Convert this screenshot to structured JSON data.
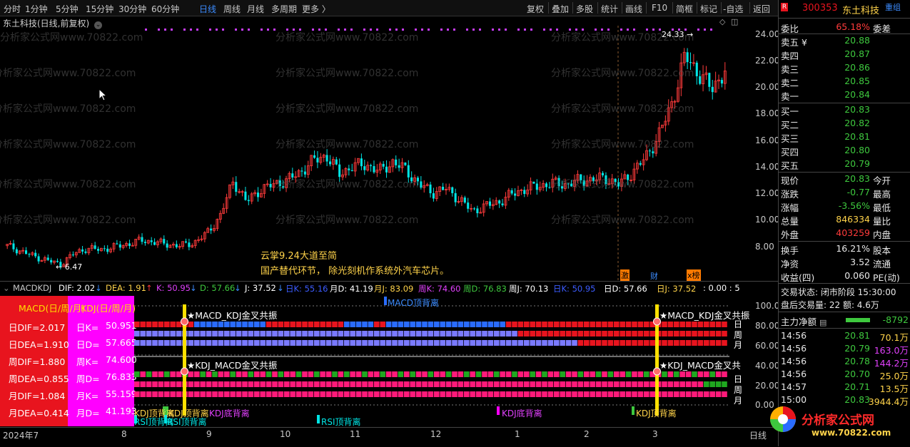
{
  "toolbar": {
    "periods": [
      "分时",
      "1分钟",
      "5分钟",
      "15分钟",
      "30分钟",
      "60分钟",
      "日线",
      "周线",
      "月线",
      "多周期",
      "更多 〉"
    ],
    "active_period": "日线",
    "right_tools": [
      "复权",
      "叠加",
      "多股",
      "统计",
      "画线",
      "F10",
      "简框",
      "标记",
      "-自选",
      "返回"
    ]
  },
  "chart": {
    "title": "东土科技(日线,前复权)",
    "y_ticks": [
      "24.00",
      "22.00",
      "20.00",
      "18.00",
      "16.00",
      "14.00",
      "12.00",
      "10.00",
      "8.00"
    ],
    "high_label": "24.33",
    "low_label": "6.47",
    "watermark": "分析家公式网www.70822.com",
    "annotation1": "云掌9.24大道至简",
    "annotation2": "国产替代环节， 除光刻机作系统外汽车芯片。",
    "event_tags": [
      "激",
      "财",
      "x榜"
    ]
  },
  "chart_data": {
    "type": "candlestick",
    "title": "东土科技(日线,前复权)",
    "ylim": [
      6.0,
      25.0
    ],
    "x_labels": [
      "2024年7",
      "8",
      "9",
      "10",
      "11",
      "12",
      "1",
      "2",
      "3"
    ],
    "close_approx": [
      8.0,
      7.6,
      7.2,
      6.9,
      6.6,
      7.4,
      7.8,
      7.7,
      7.9,
      8.1,
      8.4,
      8.3,
      8.1,
      8.0,
      8.2,
      8.9,
      10.2,
      12.9,
      11.3,
      12.2,
      12.6,
      12.9,
      13.5,
      14.4,
      14.8,
      13.4,
      14.0,
      14.1,
      13.6,
      14.3,
      13.7,
      12.6,
      12.0,
      12.3,
      11.5,
      10.6,
      11.0,
      11.3,
      11.9,
      12.3,
      12.5,
      12.7,
      12.6,
      12.9,
      13.0,
      13.1,
      12.6,
      13.5,
      14.6,
      16.3,
      18.7,
      22.3,
      21.0,
      19.8,
      21.2
    ],
    "high": 24.33,
    "low": 6.47
  },
  "indicator": {
    "name": "MACDKDJ",
    "header": [
      {
        "text": "DIF: 2.02",
        "color": "#ffffff"
      },
      {
        "text": "↓",
        "color": "#3c8cff"
      },
      {
        "text": "DEA: 1.91",
        "color": "#ffd34a"
      },
      {
        "text": "↑",
        "color": "#ff3b3b"
      },
      {
        "text": "K: 50.95",
        "color": "#e040fb"
      },
      {
        "text": "↓",
        "color": "#3c8cff"
      },
      {
        "text": "D: 57.66",
        "color": "#3ec83e"
      },
      {
        "text": "↓",
        "color": "#3c8cff"
      },
      {
        "text": "J: 37.52",
        "color": "#ffffff"
      },
      {
        "text": "↓",
        "color": "#3c8cff"
      },
      {
        "text": "日K: 55.16",
        "color": "#3c5cff"
      },
      {
        "text": "月D: 41.19",
        "color": "#ffffff"
      },
      {
        "text": "月J: 83.09",
        "color": "#ffd34a"
      },
      {
        "text": "周K: 74.60",
        "color": "#e040fb"
      },
      {
        "text": "周D: 76.83",
        "color": "#3ec83e"
      },
      {
        "text": "周J: 70.13",
        "color": "#ffffff"
      },
      {
        "text": "日K: 50.95",
        "color": "#3c5cff"
      },
      {
        "text": "日D: 57.66",
        "color": "#ffffff"
      },
      {
        "text": "日J: 37.52",
        "color": "#ffd34a"
      },
      {
        "text": ": 0.00 : 5",
        "color": "#ffffff"
      }
    ],
    "macd_head": "MACD(日/周/月)",
    "kdj_head": "KDJ(日/周/月)",
    "macd_values": [
      {
        "label": "日DIF=",
        "value": "2.017"
      },
      {
        "label": "日DEA=",
        "value": "1.910"
      },
      {
        "label": "周DIF=",
        "value": "1.880"
      },
      {
        "label": "周DEA=",
        "value": "0.855"
      },
      {
        "label": "月DIF=",
        "value": "1.084"
      },
      {
        "label": "月DEA=",
        "value": "0.414"
      }
    ],
    "kdj_values": [
      {
        "label": "日K=",
        "value": "50.951"
      },
      {
        "label": "日D=",
        "value": "57.665"
      },
      {
        "label": "周K=",
        "value": "74.600"
      },
      {
        "label": "周D=",
        "value": "76.833"
      },
      {
        "label": "月K=",
        "value": "55.159"
      },
      {
        "label": "月D=",
        "value": "41.193"
      }
    ],
    "y_ticks": [
      "100.00",
      "80.00",
      "60.00",
      "40.00",
      "20.00",
      "0.00"
    ],
    "combo1": "★MACD_KDJ金叉共振",
    "combo2": "★KDJ_MACD金叉共振",
    "combo1_right": "★MACD_KDJ金叉共振",
    "combo2_right": "★KDJ_MACD金叉共",
    "macd_divergence": "MACD顶背离",
    "row_labels": [
      "日",
      "周",
      "月",
      "日",
      "周",
      "月"
    ],
    "signals": [
      {
        "text": "KDJ顶背离",
        "color": "#ffd34a"
      },
      {
        "text": "KDJ顶背离",
        "color": "#ffd34a"
      },
      {
        "text": "KDJ底背离",
        "color": "#e040fb"
      },
      {
        "text": "RSI顶背离",
        "color": "#00e5e5"
      },
      {
        "text": "RSI顶背离",
        "color": "#00e5e5"
      },
      {
        "text": "RSI顶背离",
        "color": "#00e5e5"
      },
      {
        "text": "KDJ底背离",
        "color": "#e040fb"
      },
      {
        "text": "KDJ顶背离",
        "color": "#ffd34a"
      }
    ]
  },
  "x_axis": [
    "2024年7",
    "8",
    "9",
    "10",
    "11",
    "12",
    "1",
    "2",
    "3"
  ],
  "x_axis_right": "日线",
  "quote": {
    "code": "300353",
    "name": "东土科技",
    "tag": "重组",
    "webi_label": "委比",
    "webi_value": "65.18%",
    "weicha_label": "委差",
    "asks": [
      {
        "label": "卖五",
        "price": "20.88",
        "mark": "¥"
      },
      {
        "label": "卖四",
        "price": "20.87",
        "mark": ""
      },
      {
        "label": "卖三",
        "price": "20.86",
        "mark": ""
      },
      {
        "label": "卖二",
        "price": "20.85",
        "mark": ""
      },
      {
        "label": "卖一",
        "price": "20.84",
        "mark": ""
      }
    ],
    "bids": [
      {
        "label": "买一",
        "price": "20.83"
      },
      {
        "label": "买二",
        "price": "20.82"
      },
      {
        "label": "买三",
        "price": "20.81"
      },
      {
        "label": "买四",
        "price": "20.80"
      },
      {
        "label": "买五",
        "price": "20.79"
      }
    ],
    "stats": [
      {
        "l1": "现价",
        "v1": "20.83",
        "c1": "green",
        "l2": "今开"
      },
      {
        "l1": "涨跌",
        "v1": "-0.77",
        "c1": "green",
        "l2": "最高"
      },
      {
        "l1": "涨幅",
        "v1": "-3.56%",
        "c1": "green",
        "l2": "最低"
      },
      {
        "l1": "总量",
        "v1": "846334",
        "c1": "yellow",
        "l2": "量比"
      },
      {
        "l1": "外盘",
        "v1": "403259",
        "c1": "red",
        "l2": "内盘"
      }
    ],
    "stats2": [
      {
        "l1": "换手",
        "v1": "16.21%",
        "l2": "股本"
      },
      {
        "l1": "净资",
        "v1": "3.52",
        "l2": "流通"
      },
      {
        "l1": "收益(四)",
        "v1": "0.060",
        "l2": "PE(动)"
      }
    ],
    "trade_status": "交易状态: 闭市阶段 15:30:00",
    "after_hours": "盘后交易量: 22  额: 4.6万",
    "main_flow_label": "主力净额",
    "main_flow_value": "-8792",
    "ticks": [
      {
        "time": "14:56",
        "price": "20.81",
        "vol": "70.1万",
        "vc": "yellow"
      },
      {
        "time": "14:56",
        "price": "20.79",
        "vol": "163.0万",
        "vc": "magenta"
      },
      {
        "time": "14:56",
        "price": "20.78",
        "vol": "144.2万",
        "vc": "magenta"
      },
      {
        "time": "14:56",
        "price": "20.70",
        "vol": "25.0万",
        "vc": "yellow"
      },
      {
        "time": "14:57",
        "price": "20.71",
        "vol": "13.5万",
        "vc": "yellow"
      },
      {
        "time": "15:00",
        "price": "20.83",
        "vol": "3944.4万",
        "vc": "yellow"
      }
    ],
    "logo_text": "分析家公式网",
    "logo_url": "www.70822.com",
    "logo_icon": "R"
  },
  "colors": {
    "up": "#ff3b3b",
    "down": "#00e5e5",
    "macd_red": "#e8141e",
    "kdj_magenta": "#ff00ff",
    "signal_yellow": "#ffe000"
  }
}
